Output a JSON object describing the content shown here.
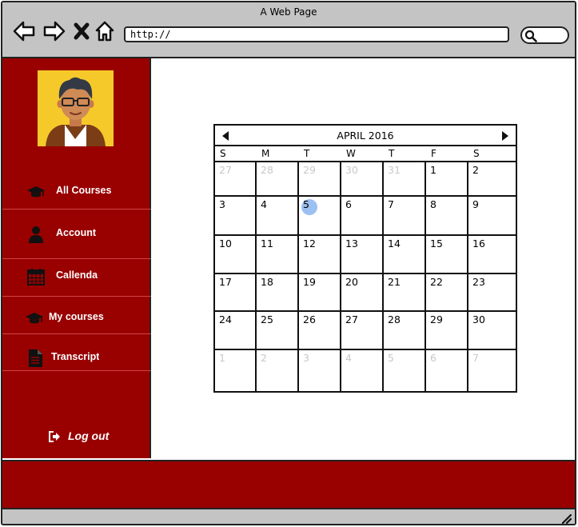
{
  "window": {
    "title": "A Web Page"
  },
  "browser": {
    "url": "http://",
    "nav_icons": [
      "back-arrow-icon",
      "forward-arrow-icon",
      "close-x-icon",
      "home-icon"
    ],
    "search_icon": "search-icon"
  },
  "sidebar": {
    "avatar": "user-avatar",
    "items": [
      {
        "label": "All Courses",
        "icon": "graduation-cap-icon"
      },
      {
        "label": "Account",
        "icon": "user-icon"
      },
      {
        "label": "Callenda",
        "icon": "calendar-icon"
      },
      {
        "label": "My courses",
        "icon": "graduation-cap-icon"
      },
      {
        "label": "Transcript",
        "icon": "document-icon"
      }
    ],
    "logout_label": "Log out",
    "logout_icon": "sign-out-icon"
  },
  "calendar": {
    "month_label": "APRIL 2016",
    "weekdays": [
      "S",
      "M",
      "T",
      "W",
      "T",
      "F",
      "S"
    ],
    "weeks": [
      [
        {
          "d": "27",
          "muted": true
        },
        {
          "d": "28",
          "muted": true
        },
        {
          "d": "29",
          "muted": true
        },
        {
          "d": "30",
          "muted": true
        },
        {
          "d": "31",
          "muted": true
        },
        {
          "d": "1"
        },
        {
          "d": "2"
        }
      ],
      [
        {
          "d": "3"
        },
        {
          "d": "4"
        },
        {
          "d": "5",
          "today": true
        },
        {
          "d": "6"
        },
        {
          "d": "7"
        },
        {
          "d": "8"
        },
        {
          "d": "9"
        }
      ],
      [
        {
          "d": "10"
        },
        {
          "d": "11"
        },
        {
          "d": "12"
        },
        {
          "d": "13"
        },
        {
          "d": "14"
        },
        {
          "d": "15"
        },
        {
          "d": "16"
        }
      ],
      [
        {
          "d": "17"
        },
        {
          "d": "18"
        },
        {
          "d": "19"
        },
        {
          "d": "20"
        },
        {
          "d": "21"
        },
        {
          "d": "22"
        },
        {
          "d": "23"
        }
      ],
      [
        {
          "d": "24"
        },
        {
          "d": "25"
        },
        {
          "d": "26"
        },
        {
          "d": "27"
        },
        {
          "d": "28"
        },
        {
          "d": "29"
        },
        {
          "d": "30"
        }
      ],
      [
        {
          "d": "1",
          "muted": true
        },
        {
          "d": "2",
          "muted": true
        },
        {
          "d": "3",
          "muted": true
        },
        {
          "d": "4",
          "muted": true
        },
        {
          "d": "5",
          "muted": true
        },
        {
          "d": "6",
          "muted": true
        },
        {
          "d": "7",
          "muted": true
        }
      ]
    ]
  },
  "colors": {
    "brand": "#990000",
    "chrome": "#c4c4c4",
    "today_highlight": "#9cc0f2",
    "muted_day": "#c8c8c8"
  }
}
